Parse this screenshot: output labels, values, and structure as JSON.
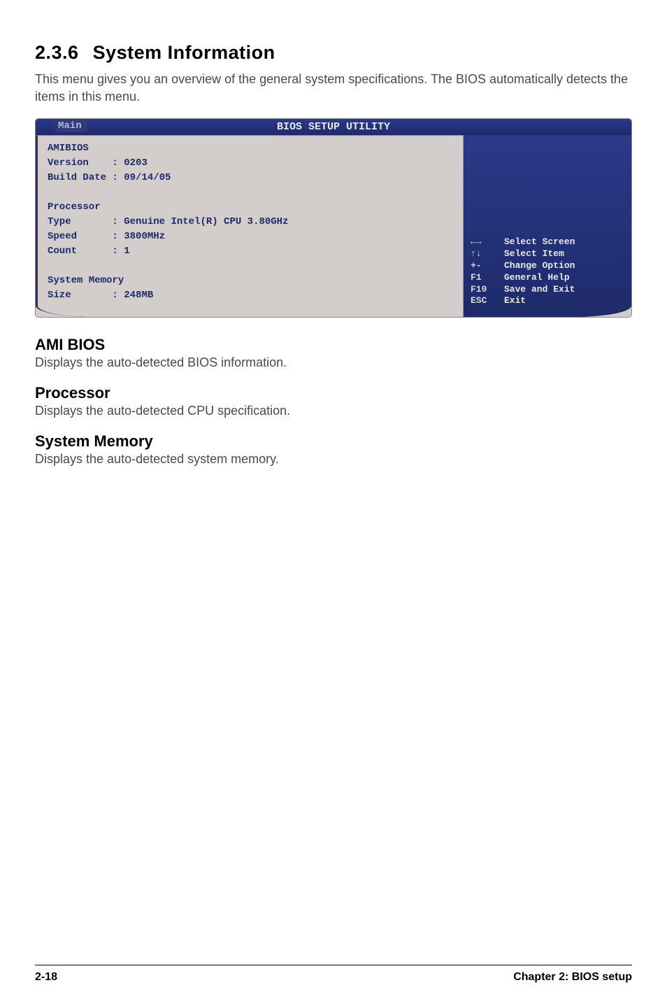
{
  "heading": {
    "number": "2.3.6",
    "title": "System Information"
  },
  "intro": "This menu gives you an overview of the general system specifications. The BIOS automatically detects the items in this menu.",
  "bios": {
    "title": "BIOS SETUP UTILITY",
    "tab": "Main",
    "sections": {
      "amibios": {
        "label": "AMIBIOS",
        "version_label": "Version",
        "version_value": "0203",
        "build_label": "Build Date",
        "build_value": "09/14/05"
      },
      "processor": {
        "label": "Processor",
        "type_label": "Type",
        "type_value": "Genuine Intel(R) CPU 3.80GHz",
        "speed_label": "Speed",
        "speed_value": "3800MHz",
        "count_label": "Count",
        "count_value": "1"
      },
      "memory": {
        "label": "System Memory",
        "size_label": "Size",
        "size_value": "248MB"
      }
    },
    "legend": [
      {
        "key": "←→",
        "label": "Select Screen"
      },
      {
        "key": "↑↓",
        "label": "Select Item"
      },
      {
        "key": "+-",
        "label": "Change Option"
      },
      {
        "key": "F1",
        "label": "General Help"
      },
      {
        "key": "F10",
        "label": "Save and Exit"
      },
      {
        "key": "ESC",
        "label": "Exit"
      }
    ]
  },
  "subsections": {
    "ami": {
      "heading": "AMI BIOS",
      "body": "Displays the auto-detected BIOS information."
    },
    "processor": {
      "heading": "Processor",
      "body": "Displays the auto-detected CPU specification."
    },
    "memory": {
      "heading": "System Memory",
      "body": "Displays the auto-detected system memory."
    }
  },
  "footer": {
    "left": "2-18",
    "right": "Chapter 2: BIOS setup"
  }
}
